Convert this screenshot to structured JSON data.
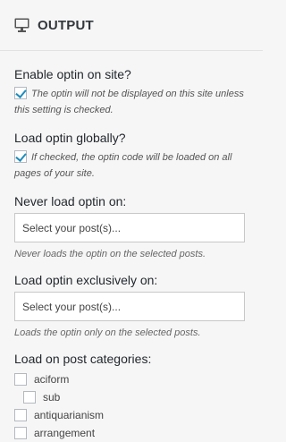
{
  "header": {
    "title": "OUTPUT",
    "icon": "monitor-icon"
  },
  "enable_optin": {
    "label": "Enable optin on site?",
    "checked": true,
    "description": "The optin will not be displayed on this site unless this setting is checked."
  },
  "load_globally": {
    "label": "Load optin globally?",
    "checked": true,
    "description": "If checked, the optin code will be loaded on all pages of your site."
  },
  "never_load": {
    "label": "Never load optin on:",
    "placeholder": "Select your post(s)...",
    "hint": "Never loads the optin on the selected posts."
  },
  "exclusive_load": {
    "label": "Load optin exclusively on:",
    "placeholder": "Select your post(s)...",
    "hint": "Loads the optin only on the selected posts."
  },
  "categories": {
    "label": "Load on post categories:",
    "items": [
      {
        "name": "aciform",
        "checked": false,
        "child": false
      },
      {
        "name": "sub",
        "checked": false,
        "child": true
      },
      {
        "name": "antiquarianism",
        "checked": false,
        "child": false
      },
      {
        "name": "arrangement",
        "checked": false,
        "child": false
      }
    ]
  }
}
